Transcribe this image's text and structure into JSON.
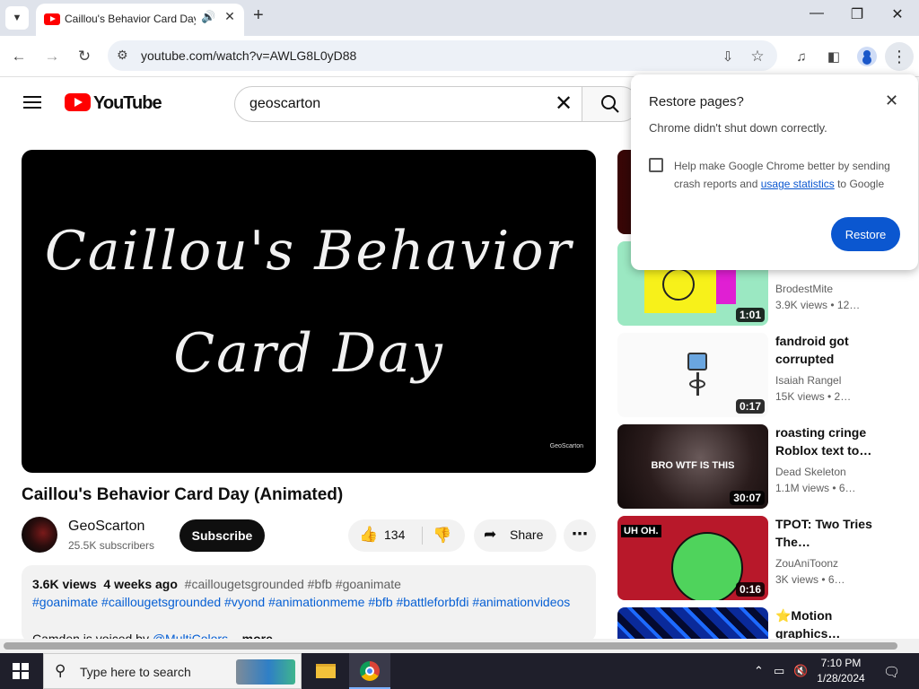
{
  "browser": {
    "tab": {
      "title": "Caillou's Behavior Card Day",
      "audio_icon": "speaker-icon",
      "close": "✕"
    },
    "new_tab": "+",
    "window_controls": {
      "minimize": "—",
      "maximize": "❐",
      "close": "✕"
    },
    "nav": {
      "back": "←",
      "forward": "→",
      "reload": "↻"
    },
    "url": "youtube.com/watch?v=AWLG8L0yD88"
  },
  "youtube": {
    "logo_text": "YouTube",
    "search": {
      "value": "geoscarton",
      "clear": "✕"
    },
    "player": {
      "line1": "Caillou's Behavior",
      "line2": "Card Day",
      "watermark": "GeoScarton"
    },
    "video": {
      "title": "Caillou's Behavior Card Day (Animated)",
      "channel": "GeoScarton",
      "subscribers": "25.5K subscribers",
      "subscribe_label": "Subscribe",
      "likes": "134",
      "share_label": "Share",
      "more": "⋯"
    },
    "description": {
      "views": "3.6K views",
      "age": "4 weeks ago",
      "hashtags_line1": "#caillougetsgrounded #bfb #goanimate",
      "hashtags_line2": "#goanimate #caillougetsgrounded #vyond #animationmeme #bfb #battleforbfdi #animationvideos",
      "line3_prefix": "Camden is voiced by ",
      "line3_link": "@MultiColors",
      "line3_more": " ...more"
    },
    "recommendations": [
      {
        "title": "",
        "channel": "",
        "meta": "",
        "duration": ""
      },
      {
        "title": "",
        "channel": "BrodestMite",
        "meta": "3.9K views • 12…",
        "duration": "1:01"
      },
      {
        "title": "fandroid got corrupted",
        "channel": "Isaiah Rangel",
        "meta": "15K views • 2…",
        "duration": "0:17"
      },
      {
        "title": "roasting cringe Roblox text to…",
        "channel": "Dead Skeleton",
        "meta": "1.1M views • 6…",
        "duration": "30:07",
        "overlay": "BRO WTF IS THIS"
      },
      {
        "title": "TPOT: Two Tries The…",
        "channel": "ZouAniToonz",
        "meta": "3K views • 6…",
        "duration": "0:16",
        "overlay": "UH OH."
      },
      {
        "title": "⭐Motion graphics…",
        "channel": "",
        "meta": "",
        "duration": ""
      }
    ]
  },
  "restore_dialog": {
    "title": "Restore pages?",
    "message": "Chrome didn't shut down correctly.",
    "checkbox_text_before": "Help make Google Chrome better by sending crash reports and ",
    "checkbox_link": "usage statistics",
    "checkbox_text_after": " to Google",
    "button": "Restore",
    "close": "✕"
  },
  "taskbar": {
    "search_placeholder": "Type here to search",
    "time": "7:10 PM",
    "date": "1/28/2024"
  },
  "colors": {
    "yt_red": "#ff0000",
    "chrome_blue": "#0b57d0",
    "taskbar": "#1f1f2b"
  }
}
